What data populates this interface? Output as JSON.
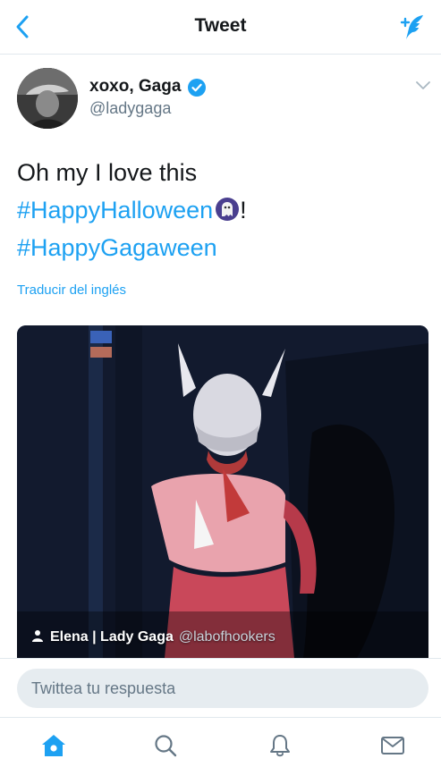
{
  "header": {
    "title": "Tweet",
    "back_icon": "chevron-left-icon",
    "compose_icon": "compose-feather-icon"
  },
  "tweet": {
    "author_name": "xoxo, Gaga",
    "handle": "@ladygaga",
    "verified": true,
    "text_line1": "Oh my I love this",
    "hashtag1": "#HappyHalloween",
    "after_emoji": "!",
    "hashtag2": "#HappyGagaween",
    "translate_label": "Traducir del inglés"
  },
  "media": {
    "attribution_name": "Elena | Lady Gaga",
    "attribution_handle": "@labofhookers"
  },
  "reply": {
    "placeholder": "Twittea tu respuesta"
  },
  "tabbar": {
    "items": [
      "home-icon",
      "search-icon",
      "notifications-bell-icon",
      "messages-envelope-icon"
    ],
    "active": "home-icon"
  },
  "colors": {
    "accent": "#1da1f2",
    "text": "#14171a",
    "secondary": "#657786",
    "input_bg": "#e6ecf0"
  }
}
